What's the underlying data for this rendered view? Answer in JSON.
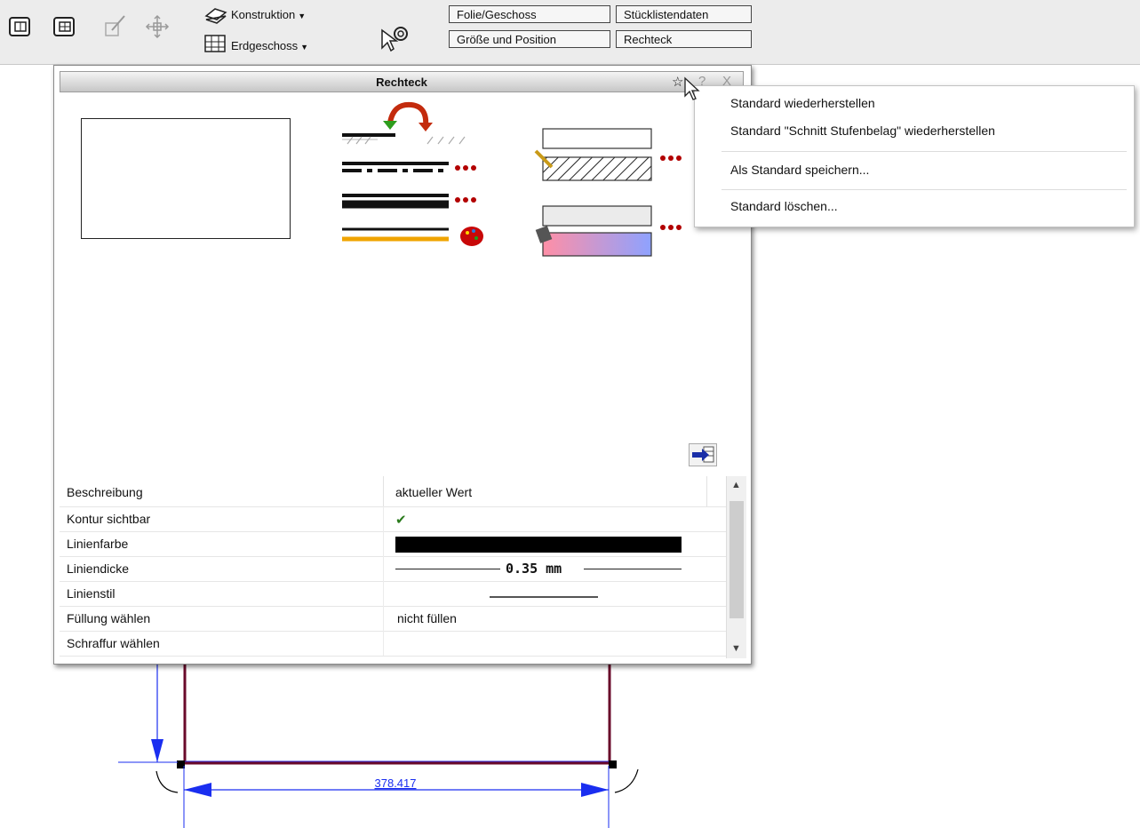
{
  "toolbar": {
    "icons": [
      "floorplan-icon",
      "floorplan-grid-icon",
      "pen-edit-icon",
      "move-arrows-icon",
      "layer-icon",
      "floor-icon",
      "pointer-gear-icon"
    ],
    "layer_dropdown": "Konstruktion",
    "floor_dropdown": "Erdgeschoss",
    "buttons": {
      "folie_geschoss": "Folie/Geschoss",
      "stuecklistendaten": "Stücklistendaten",
      "groesse_position": "Größe und Position",
      "rechteck": "Rechteck"
    }
  },
  "dialog": {
    "title": "Rechteck",
    "controls": {
      "pin": "☆",
      "help": "?",
      "close": "X"
    },
    "table": {
      "header_left": "Beschreibung",
      "header_right": "aktueller Wert",
      "rows": [
        {
          "label": "Kontur sichtbar",
          "value": "✔"
        },
        {
          "label": "Linienfarbe",
          "value": ""
        },
        {
          "label": "Liniendicke",
          "value": "0.35 mm"
        },
        {
          "label": "Linienstil",
          "value": ""
        },
        {
          "label": "Füllung wählen",
          "value": "nicht füllen"
        },
        {
          "label": "Schraffur wählen",
          "value": ""
        }
      ]
    },
    "colors": {
      "line_color": "#000000",
      "accent_orange": "#f0a400",
      "dot_red": "#b20000"
    }
  },
  "context_menu": {
    "items": [
      "Standard wiederherstellen",
      "Standard \"Schnitt Stufenbelag\" wiederherstellen",
      "Als Standard speichern...",
      "Standard löschen..."
    ]
  },
  "drawing": {
    "dimension_value": "378.417",
    "line_color": "#6a0a2a",
    "dim_color": "#1a2ef0"
  }
}
